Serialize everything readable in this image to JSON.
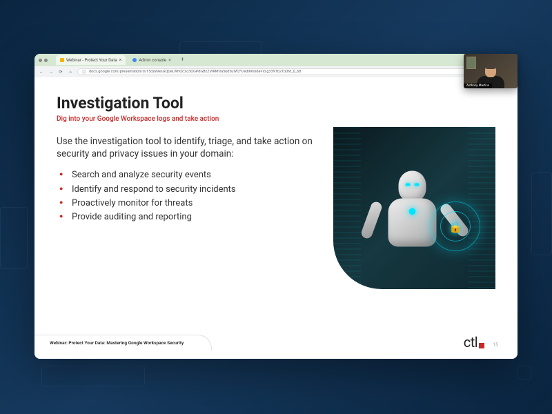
{
  "browser": {
    "tabs": [
      {
        "title": "Webinar - Protect Your Data",
        "active": true
      },
      {
        "title": "Admin console",
        "active": false
      }
    ],
    "url": "docs.google.com/presentation/d/15dze9esGQDeLWhOc2o3OGP8GBzZVlRMfra5kd5uIW2Y/edit#slide=id.g3391b21b0fd_0_68"
  },
  "slide": {
    "title": "Investigation Tool",
    "subtitle": "Dig into your Google Workspace logs and take action",
    "intro": "Use the investigation tool to identify, triage, and take action on security and privacy issues in your domain:",
    "bullets": [
      "Search and analyze security events",
      "Identify and respond to security incidents",
      "Proactively monitor for threats",
      "Provide auditing and reporting"
    ],
    "footer_label": "Webinar: Protect Your Data: Mastering Google Workspace Security",
    "logo_text": "ctl",
    "page_number": "15"
  },
  "presenter": {
    "name": "Anthony Martins"
  },
  "icons": {
    "lock": "🔒"
  }
}
